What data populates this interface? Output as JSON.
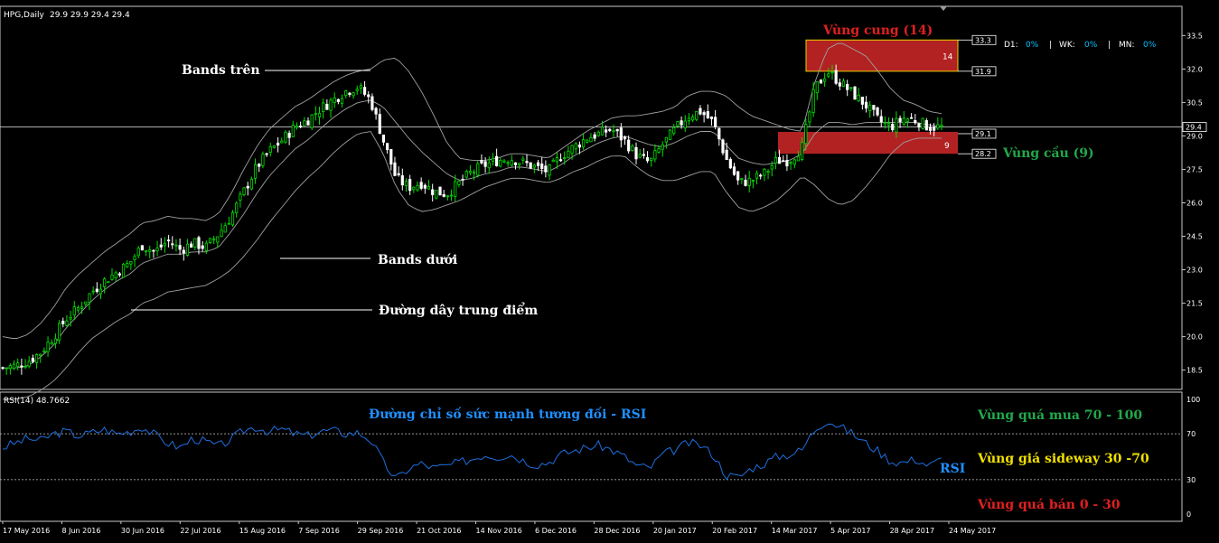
{
  "colors": {
    "background": "#000000",
    "frame": "#c8c8c8",
    "bull_candle": "#00e000",
    "bear_candle": "#ffffff",
    "band": "#a0a0a0",
    "rsi_line": "#1e6fe0",
    "supply_zone": "#b22222",
    "supply_border": "#e6d200",
    "demand_zone": "#b22222",
    "annot_red": "#e02020",
    "annot_green": "#22a84a",
    "annot_yellow": "#f0e000",
    "annot_blue": "#1e90ff",
    "annot_white": "#ffffff",
    "cyan": "#00c0ff"
  },
  "header": {
    "symbol": "HPG,Daily",
    "ohlc": "29.9 29.9 29.4 29.4"
  },
  "rsi_header": {
    "label": "RSI(14) 48.7662"
  },
  "info_panel": {
    "d1_label": "D1:",
    "d1_value": "0%",
    "sep1": "|",
    "wk_label": "WK:",
    "wk_value": "0%",
    "sep2": "|",
    "mn_label": "MN:",
    "mn_value": "0%"
  },
  "annotations": {
    "bands_upper": "Bands trên",
    "bands_lower": "Bands dưới",
    "mid_line": "Đường dây trung điểm",
    "supply_zone": "Vùng cung (14)",
    "demand_zone": "Vùng cầu (9)",
    "supply_count": "14",
    "demand_count": "9",
    "rsi_title": "Đường chỉ số sức mạnh tương đối - RSI",
    "rsi_tag": "RSI",
    "overbought": "Vùng quá mua 70 - 100",
    "sideway": "Vùng giá sideway 30 -70",
    "oversold": "Vùng quá bán 0 - 30"
  },
  "chart_data": [
    {
      "type": "candlestick",
      "title": "HPG,Daily",
      "y_range": [
        18.0,
        34.0
      ],
      "y_ticks": [
        "33.5",
        "32.0",
        "30.5",
        "29.0",
        "27.5",
        "26.0",
        "24.5",
        "23.0",
        "21.5",
        "20.0",
        "18.5"
      ],
      "x_ticks": [
        "17 May 2016",
        "8 Jun 2016",
        "30 Jun 2016",
        "22 Jul 2016",
        "15 Aug 2016",
        "7 Sep 2016",
        "29 Sep 2016",
        "21 Oct 2016",
        "14 Nov 2016",
        "6 Dec 2016",
        "28 Dec 2016",
        "20 Jan 2017",
        "20 Feb 2017",
        "14 Mar 2017",
        "5 Apr 2017",
        "28 Apr 2017",
        "24 May 2017"
      ],
      "close_path": [
        18.6,
        18.7,
        18.9,
        19.3,
        20.0,
        20.8,
        21.3,
        22.0,
        22.5,
        22.9,
        23.3,
        24.1,
        23.8,
        24.3,
        23.9,
        24.2,
        24.0,
        24.6,
        25.4,
        26.5,
        27.6,
        28.3,
        28.8,
        29.4,
        29.7,
        30.2,
        30.6,
        31.0,
        31.2,
        30.6,
        28.8,
        27.1,
        26.7,
        26.9,
        26.5,
        26.4,
        26.9,
        27.4,
        27.7,
        27.9,
        28.0,
        27.8,
        27.6,
        27.4,
        28.1,
        28.5,
        28.9,
        29.1,
        29.3,
        28.8,
        28.1,
        27.8,
        28.6,
        29.3,
        29.9,
        30.1,
        29.6,
        28.0,
        26.9,
        27.0,
        27.3,
        27.9,
        27.9,
        28.5,
        31.1,
        31.9,
        31.4,
        30.9,
        30.4,
        29.7,
        29.4,
        29.8,
        29.7,
        29.4,
        29.4
      ],
      "bands_upper": [
        20.0,
        19.9,
        20.1,
        20.6,
        21.3,
        22.2,
        22.8,
        23.3,
        23.8,
        24.2,
        24.6,
        25.1,
        25.2,
        25.4,
        25.3,
        25.3,
        25.2,
        25.5,
        26.4,
        27.5,
        28.5,
        29.3,
        29.8,
        30.3,
        30.6,
        31.0,
        31.4,
        31.7,
        31.9,
        32.0,
        32.4,
        32.5,
        31.9,
        31.0,
        29.9,
        28.7,
        28.0,
        27.9,
        27.9,
        28.0,
        28.2,
        28.2,
        28.1,
        28.0,
        28.4,
        28.8,
        29.2,
        29.5,
        29.8,
        29.9,
        29.9,
        30.0,
        30.1,
        30.3,
        30.8,
        31.0,
        31.0,
        30.8,
        30.3,
        29.9,
        29.7,
        29.5,
        29.3,
        29.2,
        31.4,
        32.9,
        33.2,
        32.9,
        32.6,
        31.9,
        31.1,
        30.6,
        30.4,
        30.1,
        30.0
      ],
      "bands_lower": [
        17.2,
        17.2,
        17.3,
        17.6,
        18.0,
        18.6,
        19.3,
        19.9,
        20.3,
        20.7,
        21.0,
        21.5,
        21.7,
        22.0,
        22.1,
        22.2,
        22.3,
        22.6,
        23.0,
        23.6,
        24.3,
        25.1,
        25.8,
        26.5,
        27.1,
        27.6,
        28.2,
        28.7,
        29.1,
        29.2,
        28.2,
        26.7,
        25.9,
        25.6,
        25.7,
        25.9,
        26.1,
        26.4,
        26.7,
        26.9,
        27.1,
        27.1,
        27.0,
        26.9,
        27.1,
        27.4,
        27.6,
        27.9,
        28.1,
        28.1,
        27.6,
        27.2,
        27.0,
        27.0,
        27.2,
        27.4,
        27.4,
        26.5,
        25.8,
        25.6,
        25.8,
        26.1,
        26.6,
        27.2,
        26.8,
        26.2,
        25.9,
        26.1,
        26.7,
        27.4,
        28.2,
        28.7,
        28.9,
        28.9,
        28.9
      ],
      "bands_mid": [
        18.6,
        18.6,
        18.7,
        19.1,
        19.6,
        20.4,
        21.0,
        21.6,
        22.1,
        22.5,
        22.8,
        23.3,
        23.5,
        23.7,
        23.7,
        23.8,
        23.8,
        24.0,
        24.7,
        25.5,
        26.4,
        27.2,
        27.8,
        28.4,
        28.8,
        29.3,
        29.8,
        30.2,
        30.5,
        30.6,
        30.3,
        29.6,
        28.9,
        28.3,
        27.8,
        27.3,
        27.0,
        27.1,
        27.3,
        27.4,
        27.6,
        27.6,
        27.5,
        27.4,
        27.7,
        28.1,
        28.4,
        28.7,
        28.9,
        29.0,
        28.8,
        28.6,
        28.5,
        28.7,
        29.0,
        29.2,
        29.2,
        28.6,
        28.0,
        27.8,
        27.7,
        27.8,
        27.9,
        28.2,
        29.1,
        29.6,
        29.6,
        29.5,
        29.6,
        29.6,
        29.6,
        29.6,
        29.6,
        29.5,
        29.4
      ],
      "last_price": 29.4,
      "supply_zone": {
        "top": 33.3,
        "bottom": 31.9,
        "count": 14,
        "label": "Vùng cung (14)"
      },
      "demand_zone": {
        "top": 29.1,
        "bottom": 28.2,
        "count": 9,
        "label": "Vùng cầu (9)"
      },
      "price_labels": [
        "33.3",
        "31.9",
        "29.4",
        "29.1",
        "28.2"
      ]
    },
    {
      "type": "line",
      "title": "RSI(14) 48.7662",
      "y_range": [
        0,
        100
      ],
      "y_ticks": [
        "100",
        "70",
        "30",
        "0"
      ],
      "levels": [
        70,
        30
      ],
      "values": [
        58,
        62,
        66,
        64,
        70,
        72,
        68,
        71,
        74,
        70,
        72,
        76,
        69,
        62,
        58,
        66,
        63,
        59,
        65,
        73,
        76,
        72,
        74,
        70,
        68,
        72,
        73,
        70,
        71,
        65,
        45,
        30,
        40,
        44,
        40,
        42,
        45,
        48,
        52,
        50,
        52,
        47,
        43,
        45,
        52,
        55,
        58,
        60,
        56,
        50,
        42,
        40,
        52,
        56,
        62,
        60,
        52,
        34,
        32,
        40,
        44,
        50,
        52,
        56,
        74,
        82,
        76,
        70,
        62,
        55,
        46,
        45,
        48,
        42,
        48
      ]
    }
  ]
}
